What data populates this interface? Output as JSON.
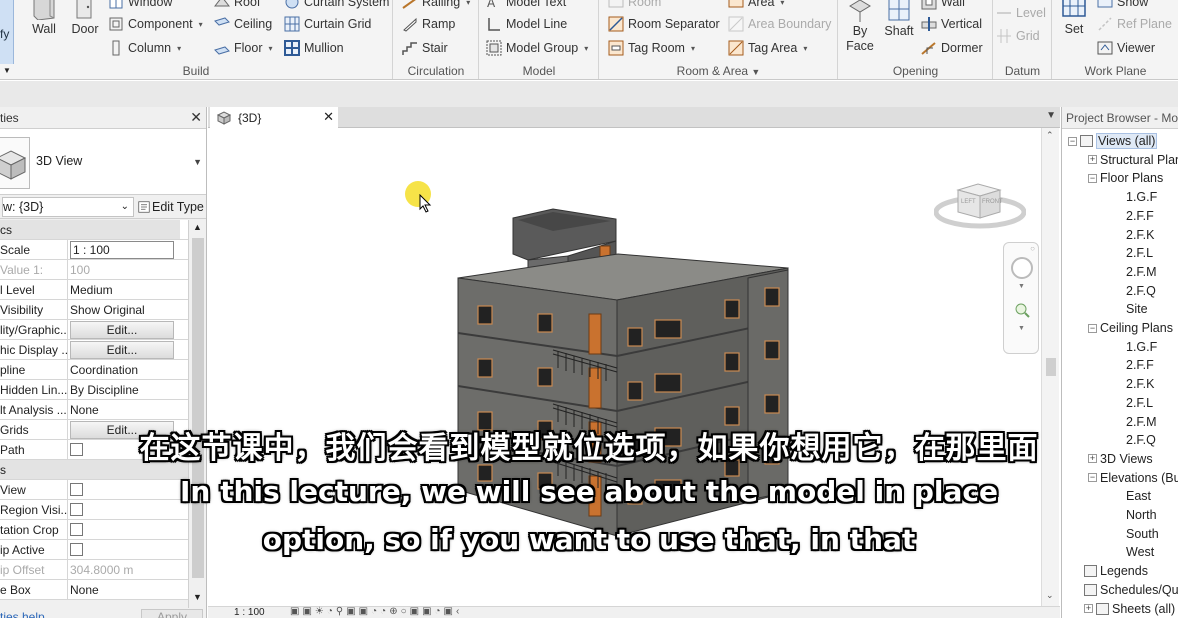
{
  "ribbon": {
    "build": {
      "title": "Build",
      "modify_partial": "fy",
      "wall": "Wall",
      "door": "Door",
      "window": "Window",
      "component": "Component",
      "column": "Column",
      "roof": "Roof",
      "ceiling": "Ceiling",
      "floor": "Floor",
      "curtain_system": "Curtain System",
      "curtain_grid": "Curtain Grid",
      "mullion": "Mullion"
    },
    "circulation": {
      "title": "Circulation",
      "railing": "Railing",
      "ramp": "Ramp",
      "stair": "Stair"
    },
    "model": {
      "title": "Model",
      "model_text": "Model Text",
      "model_line": "Model Line",
      "model_group": "Model Group"
    },
    "room_area": {
      "title": "Room & Area",
      "room": "Room",
      "room_separator": "Room Separator",
      "tag_room": "Tag Room",
      "area": "Area",
      "area_boundary": "Area Boundary",
      "tag_area": "Tag Area"
    },
    "opening": {
      "title": "Opening",
      "by_face": "By Face",
      "shaft": "Shaft",
      "wall": "Wall",
      "vertical": "Vertical",
      "dormer": "Dormer"
    },
    "datum": {
      "title": "Datum",
      "level": "Level",
      "grid": "Grid"
    },
    "work_plane": {
      "title": "Work Plane",
      "set": "Set",
      "show": "Show",
      "ref_plane": "Ref Plane",
      "viewer": "Viewer"
    }
  },
  "properties": {
    "title": "ties",
    "type_name": "3D View",
    "instance_selector": "w: {3D}",
    "edit_type": "Edit Type",
    "section_graphics": "cs",
    "rows": [
      {
        "key": "Scale",
        "value": "1 : 100",
        "kind": "box"
      },
      {
        "key": "Value   1:",
        "value": "100",
        "kind": "dim"
      },
      {
        "key": "l Level",
        "value": "Medium",
        "kind": "text"
      },
      {
        "key": "Visibility",
        "value": "Show Original",
        "kind": "text"
      },
      {
        "key": "lity/Graphic...",
        "value": "Edit...",
        "kind": "btn"
      },
      {
        "key": "hic Display ...",
        "value": "Edit...",
        "kind": "btn"
      },
      {
        "key": "pline",
        "value": "Coordination",
        "kind": "text"
      },
      {
        "key": " Hidden Lin...",
        "value": "By Discipline",
        "kind": "text"
      },
      {
        "key": "lt Analysis ...",
        "value": "None",
        "kind": "text"
      },
      {
        "key": " Grids",
        "value": "Edit...",
        "kind": "btn"
      },
      {
        "key": "Path",
        "value": "",
        "kind": "chk"
      },
      {
        "key": "s",
        "value": "",
        "kind": "section"
      },
      {
        "key": "View",
        "value": "",
        "kind": "chk"
      },
      {
        "key": "Region Visi...",
        "value": "",
        "kind": "chk"
      },
      {
        "key": "tation Crop",
        "value": "",
        "kind": "chk"
      },
      {
        "key": "ip Active",
        "value": "",
        "kind": "chk"
      },
      {
        "key": "ip Offset",
        "value": "304.8000 m",
        "kind": "dim"
      },
      {
        "key": "e Box",
        "value": "None",
        "kind": "text"
      }
    ],
    "help_link": "ties help",
    "apply": "Apply"
  },
  "view": {
    "tab_label": "{3D}",
    "scale": "1 : 100",
    "viewcube_top": "LEFT",
    "viewcube_front": "FRONT"
  },
  "project_browser": {
    "title": "Project Browser - Mo",
    "views_all": "Views (all)",
    "structural_plans": "Structural Plan",
    "floor_plans": "Floor Plans",
    "floor_items": [
      "1.G.F",
      "2.F.F",
      "2.F.K",
      "2.F.L",
      "2.F.M",
      "2.F.Q",
      "Site"
    ],
    "ceiling_plans": "Ceiling Plans",
    "ceiling_items": [
      "1.G.F",
      "2.F.F",
      "2.F.K",
      "2.F.L",
      "2.F.M",
      "2.F.Q"
    ],
    "views_3d": "3D Views",
    "elevations": "Elevations (Bu",
    "elevation_items": [
      "East",
      "North",
      "South",
      "West"
    ],
    "legends": "Legends",
    "schedules": "Schedules/Qu",
    "sheets": "Sheets (all)"
  },
  "subtitles": {
    "zh": "在这节课中，我们会看到模型就位选项，如果你想用它，在那里面",
    "en_line1": "In this lecture, we will see about the model in place",
    "en_line2": "option, so if you want to use that, in that"
  }
}
